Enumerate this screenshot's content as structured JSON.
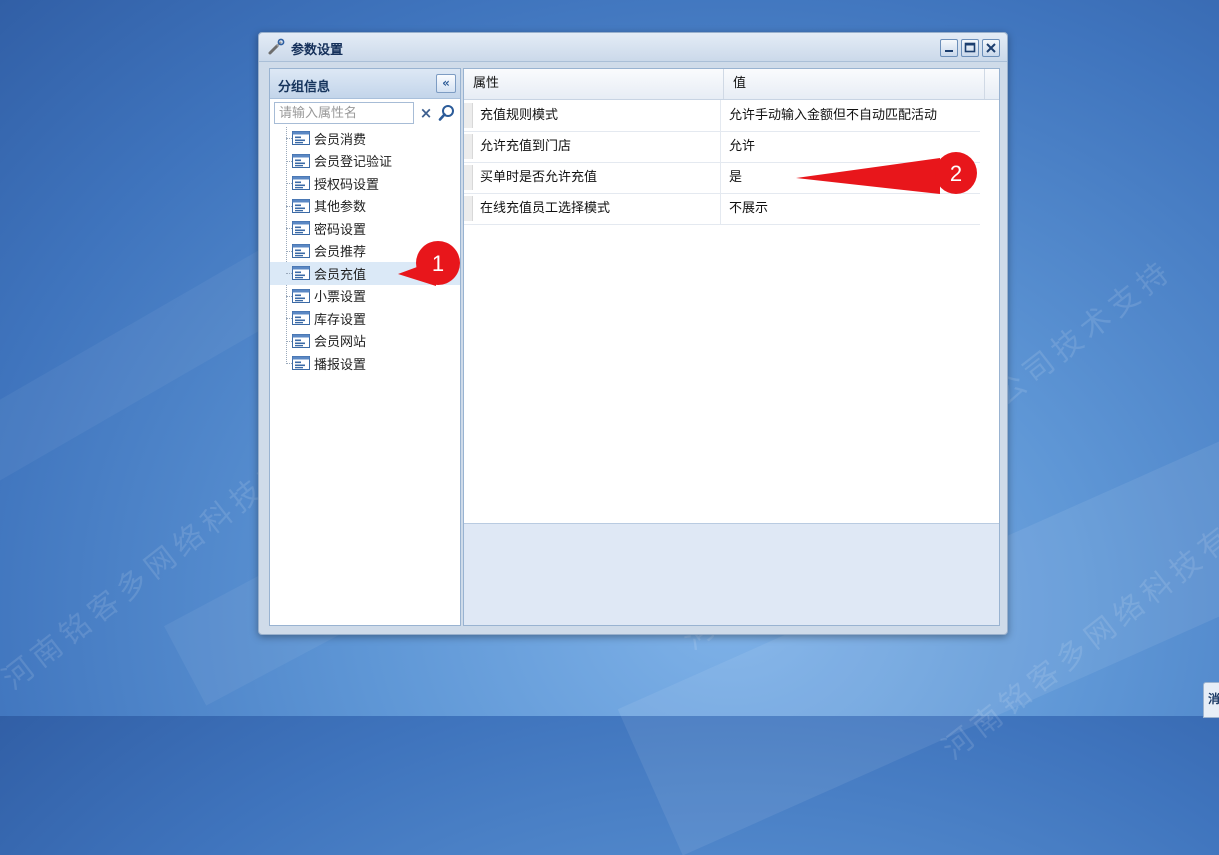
{
  "window": {
    "title": "参数设置",
    "controls": {
      "minimize": "_",
      "maximize": "□",
      "close": "✕"
    }
  },
  "left_panel": {
    "title": "分组信息",
    "collapse_label": "«",
    "search_placeholder": "请输入属性名",
    "clear_label": "×",
    "tree_items": [
      {
        "label": "会员消费"
      },
      {
        "label": "会员登记验证"
      },
      {
        "label": "授权码设置"
      },
      {
        "label": "其他参数"
      },
      {
        "label": "密码设置"
      },
      {
        "label": "会员推荐"
      },
      {
        "label": "会员充值"
      },
      {
        "label": "小票设置"
      },
      {
        "label": "库存设置"
      },
      {
        "label": "会员网站"
      },
      {
        "label": "播报设置"
      }
    ],
    "selected_label": "会员充值"
  },
  "grid": {
    "columns": {
      "property": "属性",
      "value": "值"
    },
    "rows": [
      {
        "property": "充值规则模式",
        "value": "允许手动输入金额但不自动匹配活动"
      },
      {
        "property": "允许充值到门店",
        "value": "允许"
      },
      {
        "property": "买单时是否允许充值",
        "value": "是"
      },
      {
        "property": "在线充值员工选择模式",
        "value": "不展示"
      }
    ]
  },
  "annotations": {
    "marker_1": "1",
    "marker_2": "2"
  },
  "side_tab_label": "消",
  "watermark_text": "河南铭客多网络科技有限公司技术支持",
  "colors": {
    "accent": "#e8161b",
    "selected_row": "#dbe9f7",
    "title": "#15305a"
  }
}
